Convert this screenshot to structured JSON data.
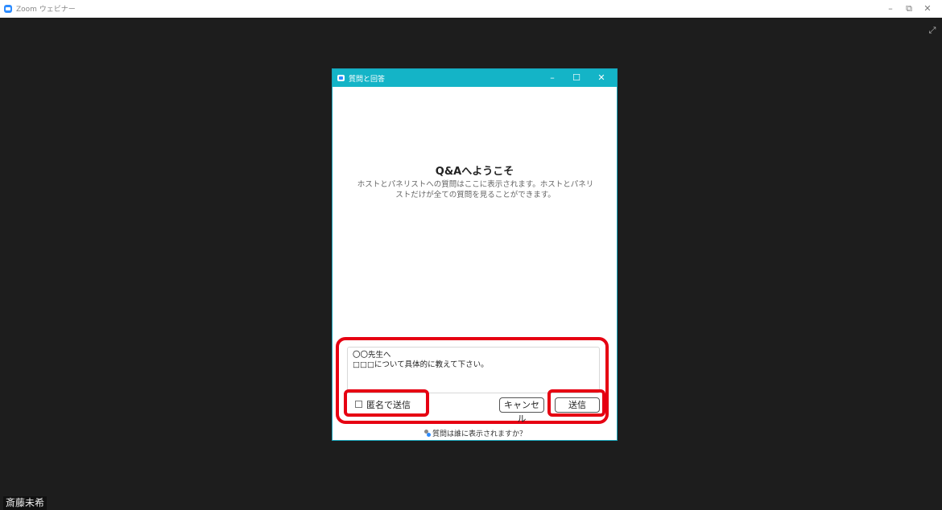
{
  "window": {
    "title": "Zoom ウェビナー",
    "minimize": "–",
    "restore": "⧉",
    "close": "✕",
    "expand": "⤢"
  },
  "participant": {
    "name": "斎藤未希"
  },
  "qa_dialog": {
    "title": "質問と回答",
    "minimize": "–",
    "maximize": "☐",
    "close": "✕",
    "welcome_title": "Q&Aへようこそ",
    "welcome_desc": "ホストとパネリストへの質問はここに表示されます。ホストとパネリストだけが全ての質問を見ることができます。",
    "question_text": "〇〇先生へ\n□□□について具体的に教えて下さい。",
    "anonymous_label": "匿名で送信",
    "anonymous_checked": false,
    "cancel_label": "キャンセル",
    "send_label": "送信",
    "who_sees_label": "質問は誰に表示されますか？"
  },
  "colors": {
    "dialog_titlebar": "#14b4c7",
    "highlight": "#e60012",
    "background": "#1d1d1d"
  }
}
